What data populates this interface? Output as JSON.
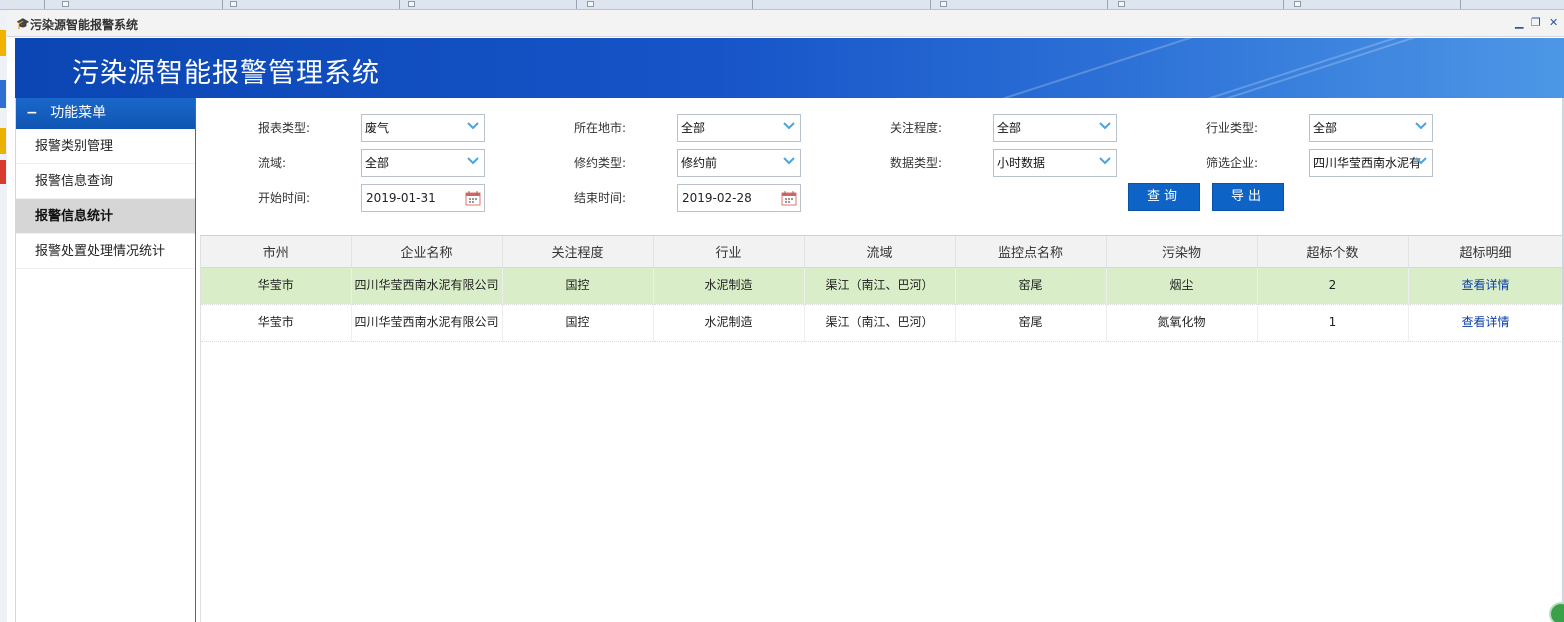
{
  "window": {
    "title": "污染源智能报警系统"
  },
  "banner": {
    "title": "污染源智能报警管理系统"
  },
  "sidebar": {
    "header": "功能菜单",
    "items": [
      {
        "label": "报警类别管理"
      },
      {
        "label": "报警信息查询"
      },
      {
        "label": "报警信息统计",
        "active": true
      },
      {
        "label": "报警处置处理情况统计"
      }
    ]
  },
  "filters": {
    "report_type_label": "报表类型:",
    "report_type_value": "废气",
    "city_label": "所在地市:",
    "city_value": "全部",
    "attention_label": "关注程度:",
    "attention_value": "全部",
    "industry_label": "行业类型:",
    "industry_value": "全部",
    "basin_label": "流域:",
    "basin_value": "全部",
    "revision_label": "修约类型:",
    "revision_value": "修约前",
    "data_type_label": "数据类型:",
    "data_type_value": "小时数据",
    "enterprise_label": "筛选企业:",
    "enterprise_value": "四川华莹西南水泥有",
    "start_label": "开始时间:",
    "start_value": "2019-01-31",
    "end_label": "结束时间:",
    "end_value": "2019-02-28",
    "query_button": "查询",
    "export_button": "导出"
  },
  "table": {
    "columns": [
      "市州",
      "企业名称",
      "关注程度",
      "行业",
      "流域",
      "监控点名称",
      "污染物",
      "超标个数",
      "超标明细"
    ],
    "rows": [
      [
        "华莹市",
        "四川华莹西南水泥有限公司",
        "国控",
        "水泥制造",
        "渠江（南江、巴河）",
        "窑尾",
        "烟尘",
        "2",
        "查看详情"
      ],
      [
        "华莹市",
        "四川华莹西南水泥有限公司",
        "国控",
        "水泥制造",
        "渠江（南江、巴河）",
        "窑尾",
        "氮氧化物",
        "1",
        "查看详情"
      ]
    ]
  },
  "colors": {
    "accent": "#0d64c6",
    "highlight_row": "#d9eec8",
    "link": "#0b3fa8"
  }
}
